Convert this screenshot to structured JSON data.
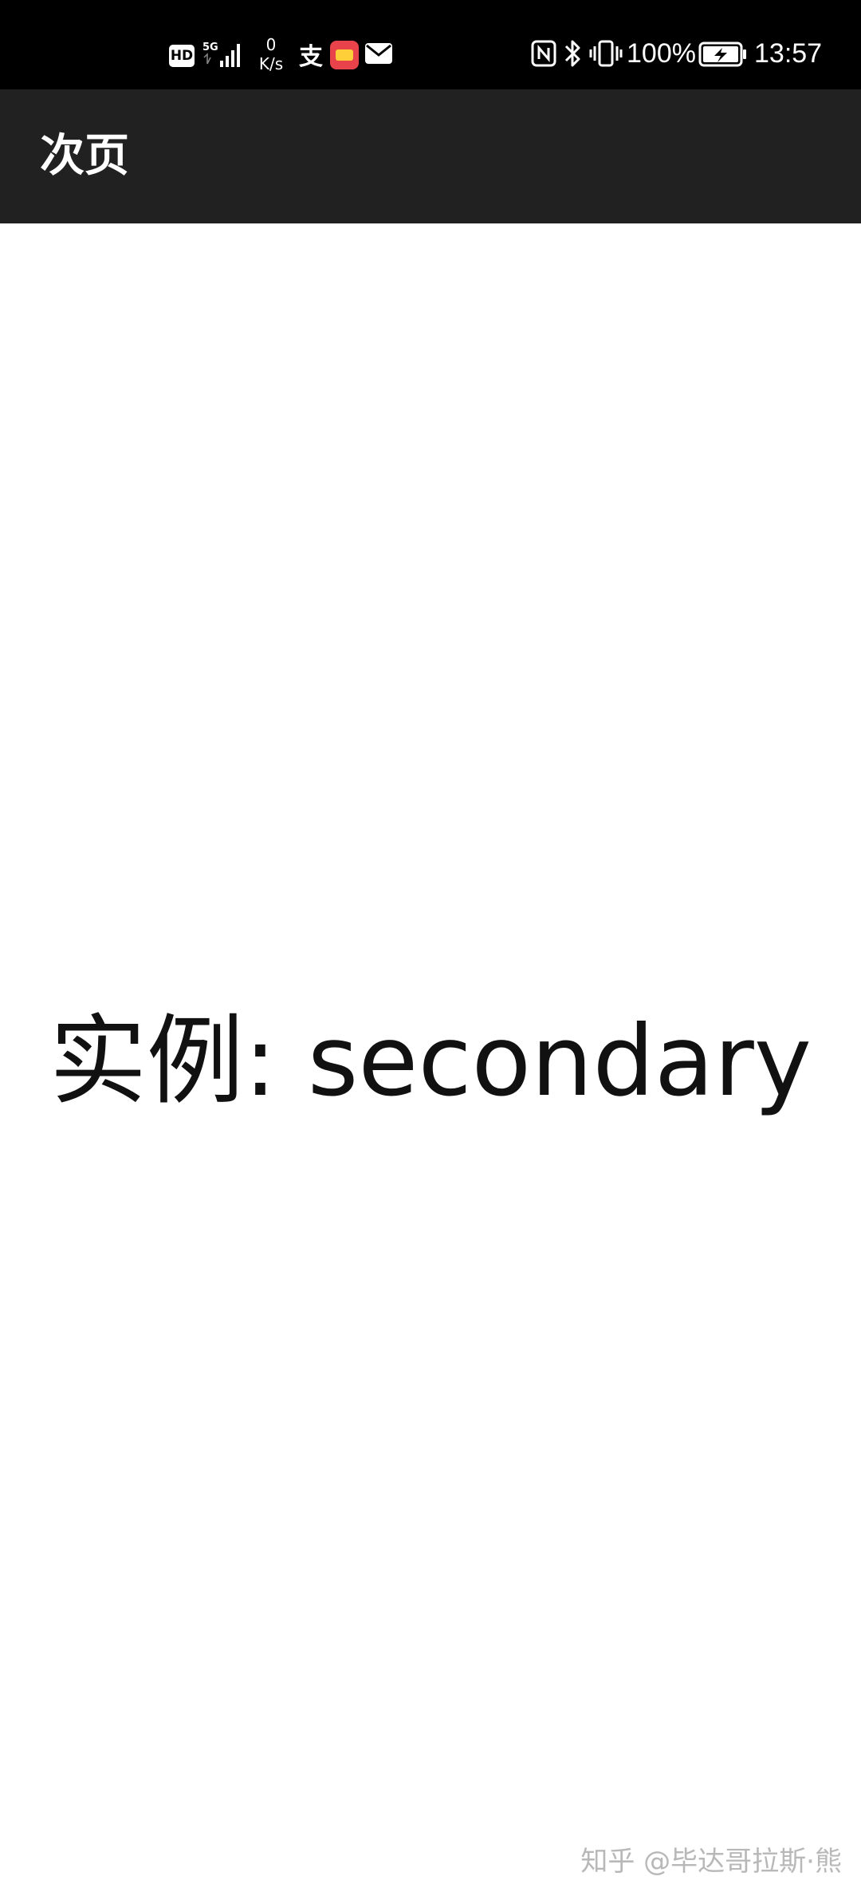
{
  "status_bar": {
    "hd_badge": "HD",
    "network_type": "5G",
    "net_speed_value": "0",
    "net_speed_unit": "K/s",
    "alipay_glyph": "支",
    "battery_percent": "100%",
    "time": "13:57",
    "icons": [
      "hd-icon",
      "signal-5g-icon",
      "alipay-icon",
      "app-notification-icon",
      "mail-icon",
      "nfc-icon",
      "bluetooth-icon",
      "vibrate-icon",
      "battery-charging-icon"
    ]
  },
  "app_bar": {
    "title": "次页"
  },
  "main": {
    "text": "实例: secondary"
  },
  "watermark": {
    "text": "知乎 @毕达哥拉斯·熊"
  },
  "colors": {
    "status_bar_bg": "#000000",
    "app_bar_bg": "#212121",
    "content_bg": "#ffffff",
    "text_primary": "#111111"
  }
}
